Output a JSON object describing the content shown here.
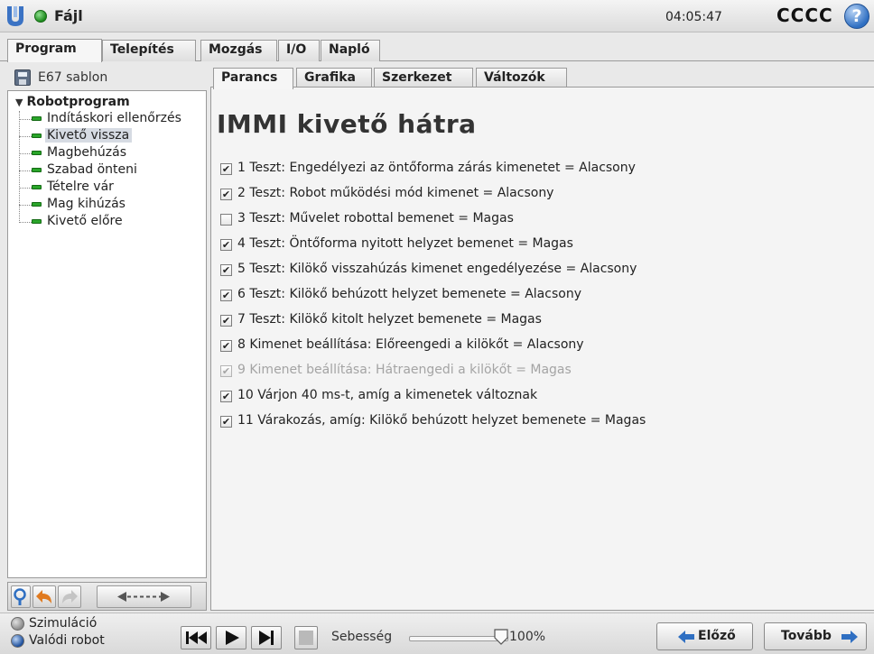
{
  "header": {
    "file_label": "Fájl",
    "clock": "04:05:47",
    "robot_name": "CCCC",
    "help_glyph": "?"
  },
  "main_tabs": [
    {
      "label": "Program",
      "active": true
    },
    {
      "label": "Telepítés",
      "active": false
    },
    {
      "label": "Mozgás",
      "active": false
    },
    {
      "label": "I/O",
      "active": false
    },
    {
      "label": "Napló",
      "active": false
    }
  ],
  "left_panel": {
    "program_name": "E67 sablon",
    "tree_root": "Robotprogram",
    "tree_items": [
      {
        "label": "Indításkori ellenőrzés",
        "selected": false
      },
      {
        "label": "Kivető vissza",
        "selected": true
      },
      {
        "label": "Magbehúzás",
        "selected": false
      },
      {
        "label": "Szabad önteni",
        "selected": false
      },
      {
        "label": "Tételre vár",
        "selected": false
      },
      {
        "label": "Mag kihúzás",
        "selected": false
      },
      {
        "label": "Kivető előre",
        "selected": false
      }
    ],
    "toolbar_icons": [
      "search-icon",
      "undo-icon",
      "redo-icon",
      "move-arrows-icon"
    ]
  },
  "sub_tabs": [
    {
      "label": "Parancs",
      "active": true
    },
    {
      "label": "Grafika",
      "active": false
    },
    {
      "label": "Szerkezet",
      "active": false
    },
    {
      "label": "Változók",
      "active": false
    }
  ],
  "content": {
    "title": "IMMI kivető hátra",
    "steps": [
      {
        "text": "1 Teszt: Engedélyezi az öntőforma zárás kimenetet = Alacsony",
        "checked": true,
        "disabled": false
      },
      {
        "text": "2 Teszt: Robot működési mód kimenet = Alacsony",
        "checked": true,
        "disabled": false
      },
      {
        "text": "3 Teszt: Művelet robottal bemenet = Magas",
        "checked": false,
        "disabled": false
      },
      {
        "text": "4 Teszt: Öntőforma nyitott helyzet bemenet = Magas",
        "checked": true,
        "disabled": false
      },
      {
        "text": "5 Teszt: Kilökő visszahúzás kimenet engedélyezése = Alacsony",
        "checked": true,
        "disabled": false
      },
      {
        "text": "6 Teszt: Kilökő behúzott helyzet bemenete = Alacsony",
        "checked": true,
        "disabled": false
      },
      {
        "text": "7 Teszt: Kilökő kitolt helyzet bemenete = Magas",
        "checked": true,
        "disabled": false
      },
      {
        "text": "8 Kimenet beállítása: Előreengedi a kilökőt = Alacsony",
        "checked": true,
        "disabled": false
      },
      {
        "text": "9 Kimenet beállítása: Hátraengedi a kilökőt = Magas",
        "checked": true,
        "disabled": true
      },
      {
        "text": "10 Várjon 40 ms-t, amíg a kimenetek változnak",
        "checked": true,
        "disabled": false
      },
      {
        "text": "11 Várakozás, amíg: Kilökő behúzott helyzet bemenete = Magas",
        "checked": true,
        "disabled": false
      }
    ]
  },
  "footer": {
    "mode_simulation": "Szimuláció",
    "mode_real": "Valódi robot",
    "speed_label": "Sebesség",
    "speed_value": "100%",
    "speed_fraction": 1.0,
    "prev_label": "Előző",
    "next_label": "Tovább",
    "colors": {
      "accent_blue": "#2f6fc2",
      "node_green": "#2aa52a",
      "undo_orange": "#e07a1f"
    }
  }
}
